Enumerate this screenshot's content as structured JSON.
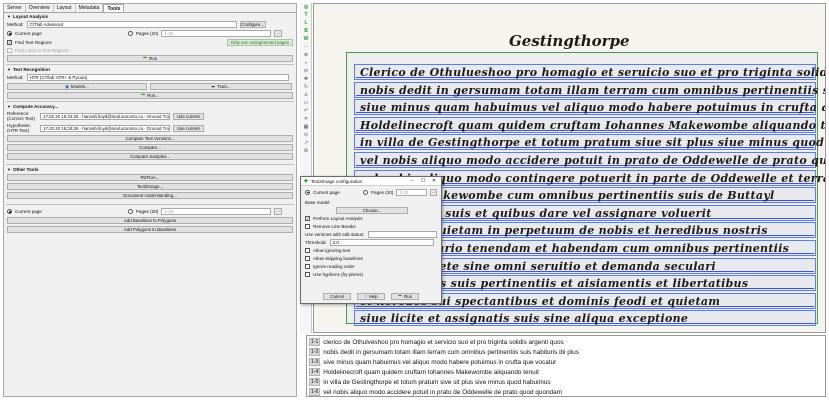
{
  "tabs": [
    "Server",
    "Overview",
    "Layout",
    "Metadata",
    "Tools"
  ],
  "layout": {
    "header": "Layout Analysis",
    "method_label": "Method:",
    "method_value": "CITlab Advanced",
    "configure": "Configure...",
    "current_page": "Current page",
    "pages_label": "Pages (20)",
    "pages_range": "1-20",
    "find_text_regions": "Find Text Regions",
    "find_lines": "Find Lines in Text Regions",
    "only_unsegmented": "Only use unsegmented pages",
    "run": "Run"
  },
  "recognition": {
    "header": "Text Recognition",
    "method_label": "Method:",
    "method_value": "HTR (CITlab HTR+ & PyLaia)",
    "models": "Models...",
    "train": "Train...",
    "run": "Run..."
  },
  "accuracy": {
    "header": "Compute Accuracy...",
    "reference_label": "Reference:",
    "reference_sub": "(Correct Text)",
    "reference_value": "17.02.20 15:34:26 - hannah.lloyd@mail.utoronto.ca - Ground Truth",
    "hypothesis_label": "Hypothesis:",
    "hypothesis_sub": "(HTR Text)",
    "hypothesis_value": "17.02.20 15:34:26 - hannah.lloyd@mail.utoronto.ca - Ground Truth",
    "use_current": "Use current",
    "compare_versions": "Compare Text Versions...",
    "compare": "Compare...",
    "compare_samples": "Compare Samples..."
  },
  "other": {
    "header": "Other Tools",
    "pdf2a": "PDFtoA...",
    "text2image": "Text2Image...",
    "doc_understanding": "Document Understanding...",
    "current_page": "Current page",
    "pages_label": "Pages (20)",
    "pages_range": "1-20",
    "add_baselines": "Add Baselines to Polygons",
    "add_polygons": "Add Polygons to Baselines"
  },
  "dialog": {
    "title": "Text2Image configuration",
    "current_page": "Current page",
    "pages_label": "Pages (20)",
    "pages_range": "1-20",
    "base_model": "Base model:",
    "choose": "Choose...",
    "perform_layout": "Perform Layout Analysis",
    "remove_line_breaks": "Remove Line Breaks",
    "use_versions": "Use versions with edit status:",
    "threshold_label": "Threshold:",
    "threshold_value": "0.0",
    "allow_ignoring": "Allow ignoring text",
    "allow_skipping": "Allow skipping baselines",
    "ignore_reading_order": "Ignore reading order",
    "use_hyphens": "Use hyphens (hy-phens)",
    "cancel": "Cancel",
    "help": "Help",
    "run": "Run"
  },
  "manuscript": {
    "title": "Gestingthorpe",
    "lines": [
      "Clerico de Othulueshoo pro homagio et seruicio suo et pro triginta solidis argenti quos",
      "nobis dedit in gersumam totam illam terram cum omnibus pertinentiis suis habituris ibi plus",
      "siue minus quam habuimus vel aliquo modo habere potuimus in crufta que vocatur",
      "Holdelinecroft quam quidem cruftam Iohannes Makewombe aliquando tenuit",
      "in villa de Gestingthorpe et totum pratum siue sit plus siue minus quod habuimus",
      "vel nobis aliquo modo accidere potuit in prato de Oddewelle de prato quod quondam",
      "vel nobis aliquo modo contingere potuerit in parte de Oddewelle et terram",
      "Iohannes Makewombe cum omnibus pertinentiis suis de Buttayl",
      "et heredibus suis et quibus dare vel assignare voluerit",
      "liberam et quietam in perpetuum de nobis et heredibus nostris",
      "iure hereditario tenendam et habendam cum omnibus pertinentiis",
      "libere et quiete sine omni seruitio et demanda seculari",
      "cum omnibus suis pertinentiis et aisiamentis et libertatibus",
      "et heredes sui spectantibus et dominis feodi et quietam",
      "siue licite et assignatis suis sine aliqua exceptione"
    ]
  },
  "transcription": [
    {
      "num": "1-1",
      "text": "clerico de Othulveshoo pro homagio et servicio suo et pro triginta solidis argenti quos"
    },
    {
      "num": "1-2",
      "text": "nobis dedit in gersumam totam illam terram cum omnibus pertinentiis suis habituris ibi plus"
    },
    {
      "num": "1-3",
      "text": "sive minus quam habuimus vel aliquo modo habere potuimus in crufta que vocatur"
    },
    {
      "num": "1-4",
      "text": "Holdelinecroft quam quidem cruftam Iohannes Makewombe aliquando tenuit"
    },
    {
      "num": "1-5",
      "text": "in villa de Gestingthorpe et totum pratum sive sit plus sive minus quod habuimus"
    },
    {
      "num": "1-6",
      "text": "vel nobis aliquo modo accidere potuit in prato de Oddewelle de prato quod quondam"
    }
  ],
  "colors": {
    "polygon": "#5b7fe0",
    "baseline": "#3f56c8",
    "accent_green": "#2e9d2e"
  }
}
